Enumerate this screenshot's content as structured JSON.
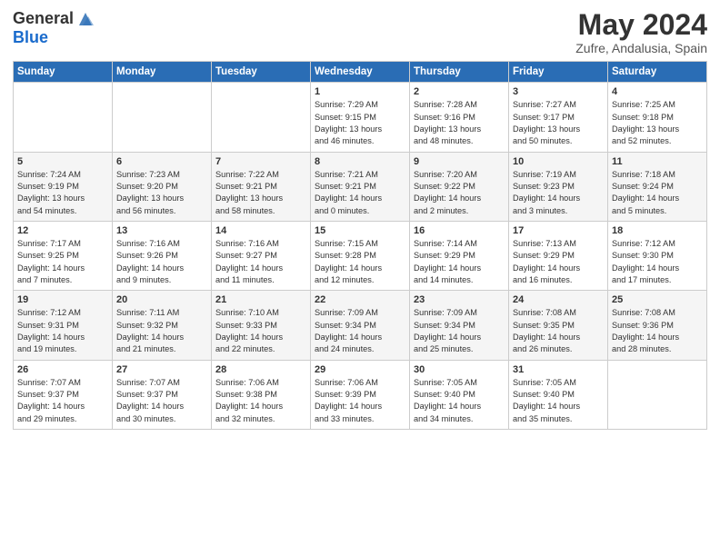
{
  "header": {
    "logo_general": "General",
    "logo_blue": "Blue",
    "title": "May 2024",
    "location": "Zufre, Andalusia, Spain"
  },
  "days_of_week": [
    "Sunday",
    "Monday",
    "Tuesday",
    "Wednesday",
    "Thursday",
    "Friday",
    "Saturday"
  ],
  "weeks": [
    [
      {
        "day": "",
        "info": ""
      },
      {
        "day": "",
        "info": ""
      },
      {
        "day": "",
        "info": ""
      },
      {
        "day": "1",
        "info": "Sunrise: 7:29 AM\nSunset: 9:15 PM\nDaylight: 13 hours\nand 46 minutes."
      },
      {
        "day": "2",
        "info": "Sunrise: 7:28 AM\nSunset: 9:16 PM\nDaylight: 13 hours\nand 48 minutes."
      },
      {
        "day": "3",
        "info": "Sunrise: 7:27 AM\nSunset: 9:17 PM\nDaylight: 13 hours\nand 50 minutes."
      },
      {
        "day": "4",
        "info": "Sunrise: 7:25 AM\nSunset: 9:18 PM\nDaylight: 13 hours\nand 52 minutes."
      }
    ],
    [
      {
        "day": "5",
        "info": "Sunrise: 7:24 AM\nSunset: 9:19 PM\nDaylight: 13 hours\nand 54 minutes."
      },
      {
        "day": "6",
        "info": "Sunrise: 7:23 AM\nSunset: 9:20 PM\nDaylight: 13 hours\nand 56 minutes."
      },
      {
        "day": "7",
        "info": "Sunrise: 7:22 AM\nSunset: 9:21 PM\nDaylight: 13 hours\nand 58 minutes."
      },
      {
        "day": "8",
        "info": "Sunrise: 7:21 AM\nSunset: 9:21 PM\nDaylight: 14 hours\nand 0 minutes."
      },
      {
        "day": "9",
        "info": "Sunrise: 7:20 AM\nSunset: 9:22 PM\nDaylight: 14 hours\nand 2 minutes."
      },
      {
        "day": "10",
        "info": "Sunrise: 7:19 AM\nSunset: 9:23 PM\nDaylight: 14 hours\nand 3 minutes."
      },
      {
        "day": "11",
        "info": "Sunrise: 7:18 AM\nSunset: 9:24 PM\nDaylight: 14 hours\nand 5 minutes."
      }
    ],
    [
      {
        "day": "12",
        "info": "Sunrise: 7:17 AM\nSunset: 9:25 PM\nDaylight: 14 hours\nand 7 minutes."
      },
      {
        "day": "13",
        "info": "Sunrise: 7:16 AM\nSunset: 9:26 PM\nDaylight: 14 hours\nand 9 minutes."
      },
      {
        "day": "14",
        "info": "Sunrise: 7:16 AM\nSunset: 9:27 PM\nDaylight: 14 hours\nand 11 minutes."
      },
      {
        "day": "15",
        "info": "Sunrise: 7:15 AM\nSunset: 9:28 PM\nDaylight: 14 hours\nand 12 minutes."
      },
      {
        "day": "16",
        "info": "Sunrise: 7:14 AM\nSunset: 9:29 PM\nDaylight: 14 hours\nand 14 minutes."
      },
      {
        "day": "17",
        "info": "Sunrise: 7:13 AM\nSunset: 9:29 PM\nDaylight: 14 hours\nand 16 minutes."
      },
      {
        "day": "18",
        "info": "Sunrise: 7:12 AM\nSunset: 9:30 PM\nDaylight: 14 hours\nand 17 minutes."
      }
    ],
    [
      {
        "day": "19",
        "info": "Sunrise: 7:12 AM\nSunset: 9:31 PM\nDaylight: 14 hours\nand 19 minutes."
      },
      {
        "day": "20",
        "info": "Sunrise: 7:11 AM\nSunset: 9:32 PM\nDaylight: 14 hours\nand 21 minutes."
      },
      {
        "day": "21",
        "info": "Sunrise: 7:10 AM\nSunset: 9:33 PM\nDaylight: 14 hours\nand 22 minutes."
      },
      {
        "day": "22",
        "info": "Sunrise: 7:09 AM\nSunset: 9:34 PM\nDaylight: 14 hours\nand 24 minutes."
      },
      {
        "day": "23",
        "info": "Sunrise: 7:09 AM\nSunset: 9:34 PM\nDaylight: 14 hours\nand 25 minutes."
      },
      {
        "day": "24",
        "info": "Sunrise: 7:08 AM\nSunset: 9:35 PM\nDaylight: 14 hours\nand 26 minutes."
      },
      {
        "day": "25",
        "info": "Sunrise: 7:08 AM\nSunset: 9:36 PM\nDaylight: 14 hours\nand 28 minutes."
      }
    ],
    [
      {
        "day": "26",
        "info": "Sunrise: 7:07 AM\nSunset: 9:37 PM\nDaylight: 14 hours\nand 29 minutes."
      },
      {
        "day": "27",
        "info": "Sunrise: 7:07 AM\nSunset: 9:37 PM\nDaylight: 14 hours\nand 30 minutes."
      },
      {
        "day": "28",
        "info": "Sunrise: 7:06 AM\nSunset: 9:38 PM\nDaylight: 14 hours\nand 32 minutes."
      },
      {
        "day": "29",
        "info": "Sunrise: 7:06 AM\nSunset: 9:39 PM\nDaylight: 14 hours\nand 33 minutes."
      },
      {
        "day": "30",
        "info": "Sunrise: 7:05 AM\nSunset: 9:40 PM\nDaylight: 14 hours\nand 34 minutes."
      },
      {
        "day": "31",
        "info": "Sunrise: 7:05 AM\nSunset: 9:40 PM\nDaylight: 14 hours\nand 35 minutes."
      },
      {
        "day": "",
        "info": ""
      }
    ]
  ]
}
